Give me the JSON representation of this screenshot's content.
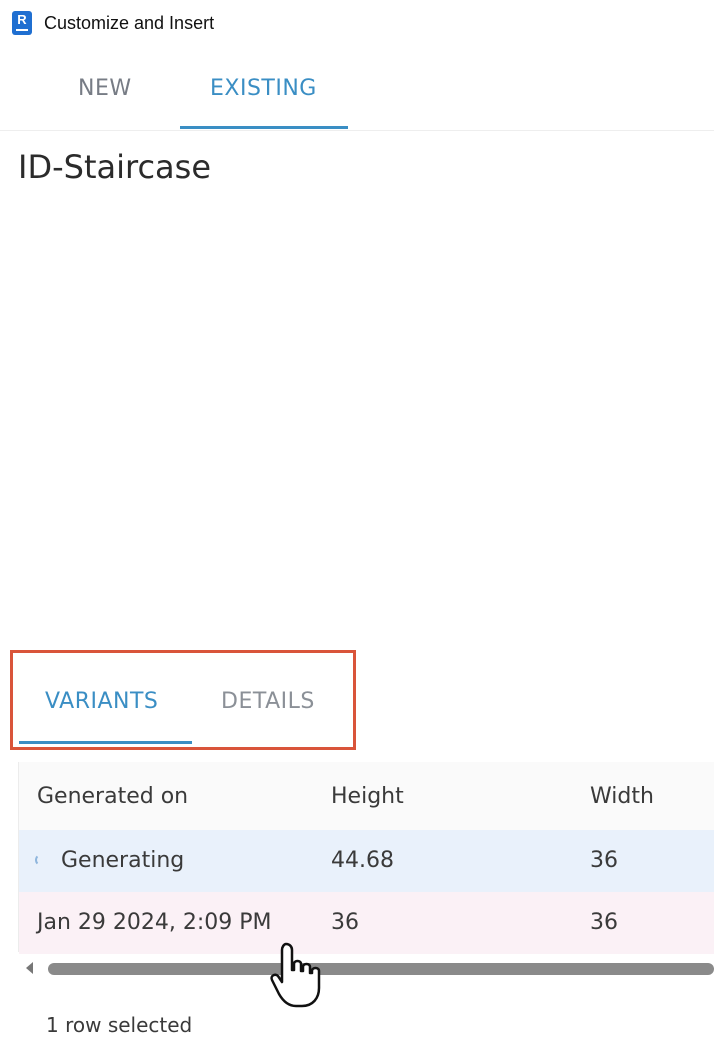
{
  "window": {
    "title": "Customize and Insert",
    "app_icon_letter": "R",
    "app_icon_name": "revit-app-icon"
  },
  "top_tabs": [
    {
      "label": "NEW",
      "active": false
    },
    {
      "label": "EXISTING",
      "active": true
    }
  ],
  "page_title": "ID-Staircase",
  "sub_tabs": [
    {
      "label": "VARIANTS",
      "active": true
    },
    {
      "label": "DETAILS",
      "active": false
    }
  ],
  "grid": {
    "columns": [
      "Generated on",
      "Height",
      "Width"
    ],
    "rows": [
      {
        "generated_on": "Generating",
        "height": "44.68",
        "width": "36",
        "loading": true
      },
      {
        "generated_on": "Jan 29 2024, 2:09 PM",
        "height": "36",
        "width": "36",
        "loading": false
      }
    ]
  },
  "status": "1 row selected",
  "colors": {
    "accent": "#3a8ec4",
    "highlight_border": "#d9543a",
    "row_generating_bg": "#e9f1fb",
    "row_selected_bg": "#fbf1f6"
  },
  "icons": {
    "cursor": "hand-pointer-icon",
    "loading": "spinner-icon",
    "scroll": "scroll-left-arrow-icon"
  }
}
